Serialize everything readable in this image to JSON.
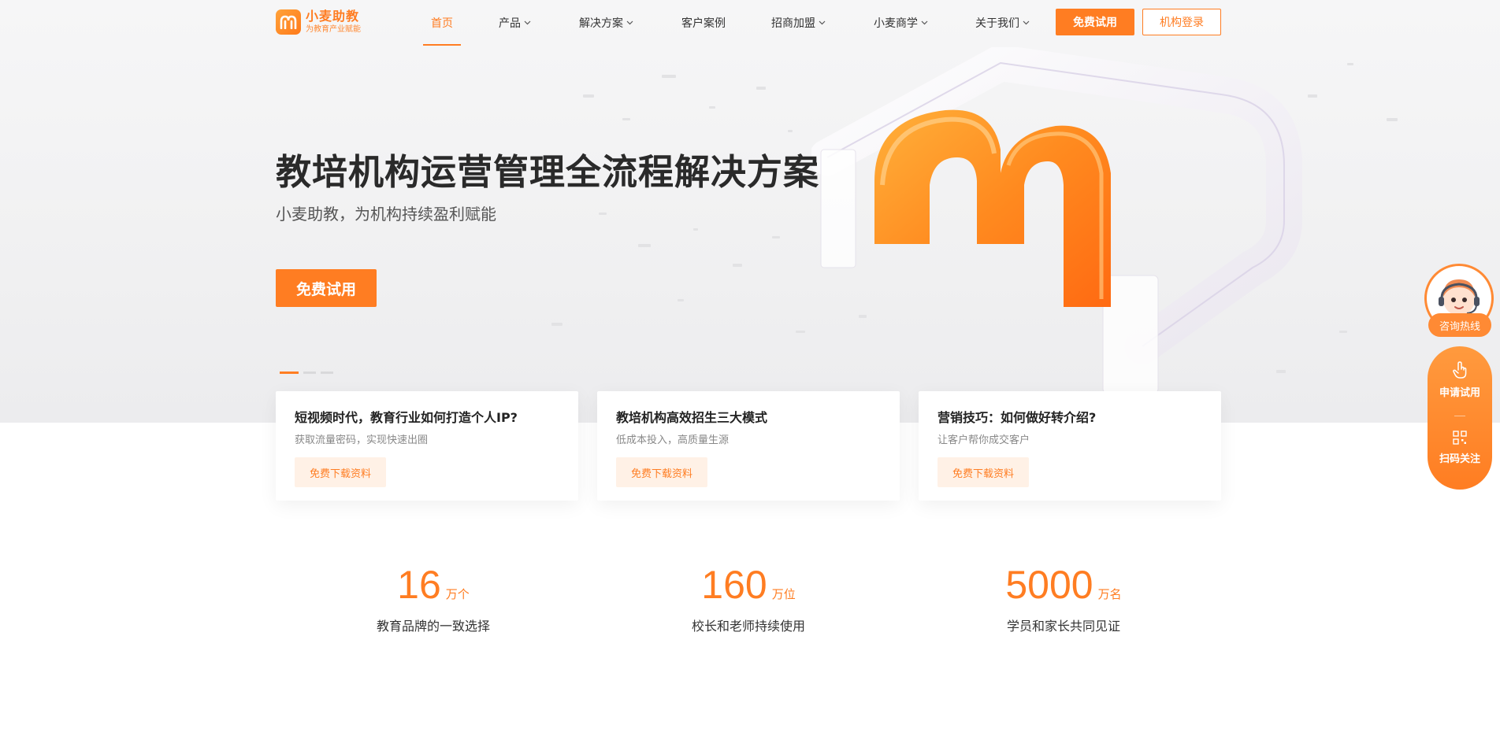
{
  "brand": {
    "name": "小麦助教",
    "slogan": "为教育产业赋能"
  },
  "nav": {
    "items": [
      {
        "label": "首页",
        "active": true,
        "dropdown": false
      },
      {
        "label": "产品",
        "dropdown": true
      },
      {
        "label": "解决方案",
        "dropdown": true
      },
      {
        "label": "客户案例",
        "dropdown": false
      },
      {
        "label": "招商加盟",
        "dropdown": true
      },
      {
        "label": "小麦商学",
        "dropdown": true
      },
      {
        "label": "关于我们",
        "dropdown": true
      }
    ],
    "trial_label": "免费试用",
    "login_label": "机构登录"
  },
  "hero": {
    "title": "教培机构运营管理全流程解决方案",
    "subtitle": "小麦助教，为机构持续盈利赋能",
    "cta_label": "免费试用",
    "slides_total": 3,
    "slide_active": 1
  },
  "cards": [
    {
      "title": "短视频时代，教育行业如何打造个人IP?",
      "desc": "获取流量密码，实现快速出圈",
      "button": "免费下载资料"
    },
    {
      "title": "教培机构高效招生三大模式",
      "desc": "低成本投入，高质量生源",
      "button": "免费下载资料"
    },
    {
      "title": "营销技巧：如何做好转介绍?",
      "desc": "让客户帮你成交客户",
      "button": "免费下载资料"
    }
  ],
  "stats": [
    {
      "value": "16",
      "unit": "万个",
      "label": "教育品牌的一致选择"
    },
    {
      "value": "160",
      "unit": "万位",
      "label": "校长和老师持续使用"
    },
    {
      "value": "5000",
      "unit": "万名",
      "label": "学员和家长共同见证"
    }
  ],
  "side": {
    "hotline_label": "咨询热线",
    "trial_label": "申请试用",
    "follow_label": "扫码关注"
  },
  "colors": {
    "accent": "#ff7d22",
    "accent_light": "#fff1e6",
    "text": "#333333"
  },
  "icons": {
    "chevron": "chevron-down-icon",
    "trial": "hand-pointer-icon",
    "follow": "qr-code-icon",
    "hotline": "customer-service-avatar"
  }
}
